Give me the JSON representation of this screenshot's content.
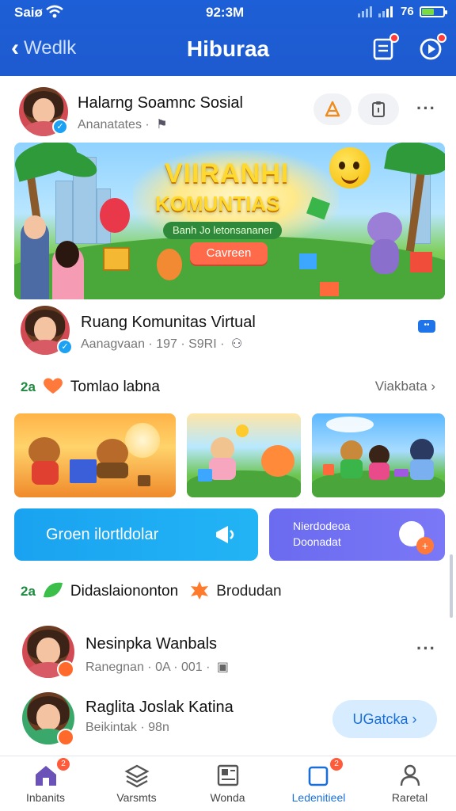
{
  "status_bar": {
    "carrier": "Saiø",
    "time": "92:3M",
    "battery_text": "76"
  },
  "header": {
    "back_label": "Wedlk",
    "title": "Hiburaa"
  },
  "post1": {
    "author": "Halarng Soamnc Sosial",
    "meta": "Ananatates ·"
  },
  "banner": {
    "title_line1": "VIIRANHI",
    "title_line2": "KOMUNTIAS",
    "subtitle": "Banh Jo letonsananer",
    "cta": "Cavreen"
  },
  "post2": {
    "author": "Ruang Komunitas Virtual",
    "meta": "Aanagvaan · 197 · S9RI ·"
  },
  "section1": {
    "count": "2a",
    "title": "Tomlao labna",
    "link": "Viakbata"
  },
  "cta_blue": {
    "label": "Groen ilortldolar"
  },
  "cta_purple": {
    "line1": "Nierdodeoa",
    "line2": "Doonadat"
  },
  "section2": {
    "count": "2a",
    "title": "Didaslaiononton",
    "extra": "Brodudan"
  },
  "users": [
    {
      "name": "Nesinpka Wanbals",
      "meta": "Ranegnan · 0A · 001 ·"
    },
    {
      "name": "Raglita Joslak Katina",
      "meta": "Beikintak · 98n",
      "button": "UGatcka"
    }
  ],
  "bottom_nav": [
    {
      "label": "Inbanits",
      "icon": "home-icon",
      "badge": "2"
    },
    {
      "label": "Varsmts",
      "icon": "layers-icon"
    },
    {
      "label": "Wonda",
      "icon": "news-icon"
    },
    {
      "label": "Ledenitieel",
      "icon": "chat-square-icon",
      "badge": "2"
    },
    {
      "label": "Raretal",
      "icon": "profile-icon"
    }
  ],
  "colors": {
    "header": "#1e5ad0",
    "accent_blue": "#1aa2f0",
    "accent_purple": "#6b6bf0",
    "active_nav": "#1a6fd6",
    "count_green": "#1d8a3f"
  }
}
